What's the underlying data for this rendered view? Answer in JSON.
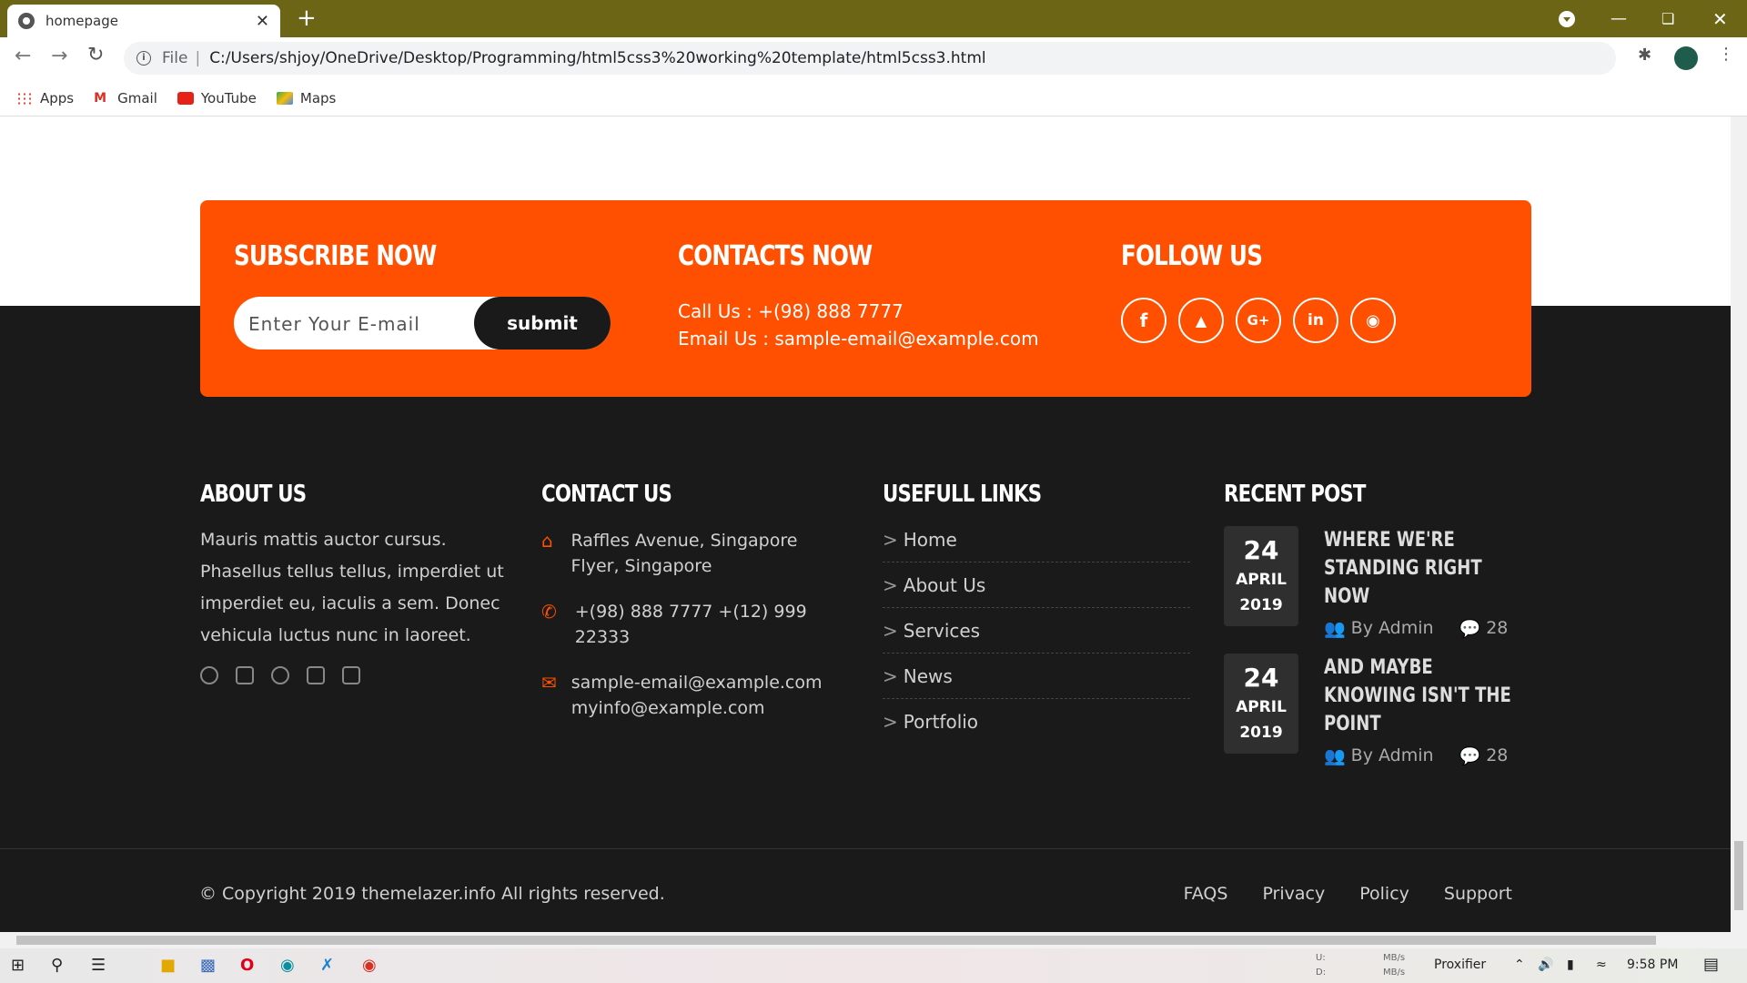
{
  "browser": {
    "tab_title": "homepage",
    "new_tab": "+",
    "close_tab": "✕",
    "url_prefix": "File",
    "url": "C:/Users/shjoy/OneDrive/Desktop/Programming/html5css3%20working%20template/html5css3.html",
    "bookmarks": [
      "Apps",
      "Gmail",
      "YouTube",
      "Maps"
    ]
  },
  "subscribe": {
    "heading": "SUBSCRIBE NOW",
    "placeholder": "Enter Your E-mail",
    "button": "submit"
  },
  "contacts_now": {
    "heading": "CONTACTS NOW",
    "call": "Call Us : +(98) 888 7777",
    "email": "Email Us : sample-email@example.com"
  },
  "follow": {
    "heading": "FOLLOW US",
    "icons": [
      "facebook-icon",
      "twitter-icon",
      "google-plus-icon",
      "linkedin-icon",
      "instagram-icon"
    ]
  },
  "about": {
    "heading": "ABOUT US",
    "text": "Mauris mattis auctor cursus. Phasellus tellus tellus, imperdiet ut imperdiet eu, iaculis a sem. Donec vehicula luctus nunc in laoreet."
  },
  "contact": {
    "heading": "CONTACT US",
    "address": "Raffles Avenue, Singapore Flyer, Singapore",
    "phone": "+(98) 888 7777 +(12) 999 22333",
    "email": "sample-email@example.com myinfo@example.com"
  },
  "links": {
    "heading": "USEFULL LINKS",
    "items": [
      "Home",
      "About Us",
      "Services",
      "News",
      "Portfolio"
    ]
  },
  "recent": {
    "heading": "RECENT POST",
    "posts": [
      {
        "day": "24",
        "month": "APRIL",
        "year": "2019",
        "title": "WHERE WE'RE STANDING RIGHT NOW",
        "author": "By Admin",
        "comments": "28"
      },
      {
        "day": "24",
        "month": "APRIL",
        "year": "2019",
        "title": "AND MAYBE KNOWING ISN'T THE POINT",
        "author": "By Admin",
        "comments": "28"
      }
    ]
  },
  "footer": {
    "copyright": "© Copyright 2019 themelazer.info All rights reserved.",
    "links": [
      "FAQS",
      "Privacy",
      "Policy",
      "Support"
    ]
  },
  "taskbar": {
    "proxifier": "Proxifier",
    "time": "9:58 PM",
    "net_up": "U:",
    "net_down": "D:",
    "net_unit": "MB/s"
  },
  "colors": {
    "accent": "#fe5000",
    "dark": "#1b1a1a",
    "titlebar": "#6b6515"
  }
}
